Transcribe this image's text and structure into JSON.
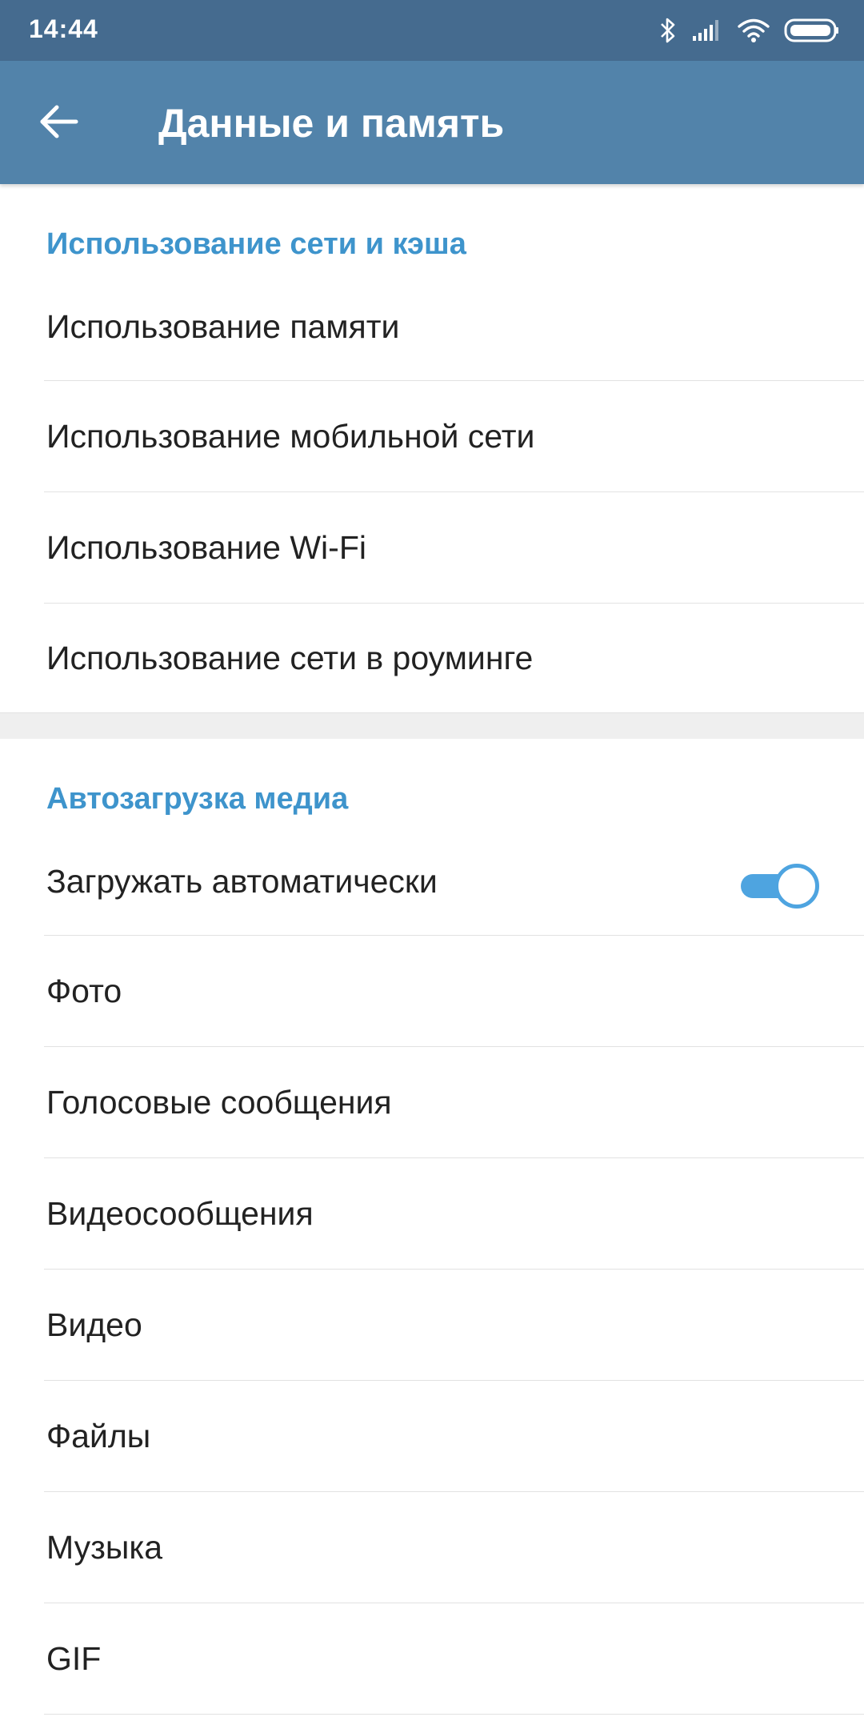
{
  "status_bar": {
    "time": "14:44",
    "icons": [
      "bluetooth-icon",
      "signal-icon",
      "wifi-icon",
      "battery-icon"
    ]
  },
  "app_bar": {
    "title": "Данные и память",
    "back_icon": "arrow-left-icon"
  },
  "sections": {
    "network": {
      "header": "Использование сети и кэша",
      "items": [
        {
          "label": "Использование памяти"
        },
        {
          "label": "Использование мобильной сети"
        },
        {
          "label": "Использование Wi-Fi"
        },
        {
          "label": "Использование сети в роуминге"
        }
      ]
    },
    "autodownload": {
      "header": "Автозагрузка медиа",
      "toggle_row": {
        "label": "Загружать автоматически",
        "enabled": true
      },
      "items": [
        {
          "label": "Фото"
        },
        {
          "label": "Голосовые сообщения"
        },
        {
          "label": "Видеосообщения"
        },
        {
          "label": "Видео"
        },
        {
          "label": "Файлы"
        },
        {
          "label": "Музыка"
        },
        {
          "label": "GIF"
        }
      ]
    }
  },
  "colors": {
    "status_bar": "#456b8f",
    "app_bar": "#5283aa",
    "section_header": "#3e94cc",
    "toggle_on": "#4ea4e0"
  }
}
